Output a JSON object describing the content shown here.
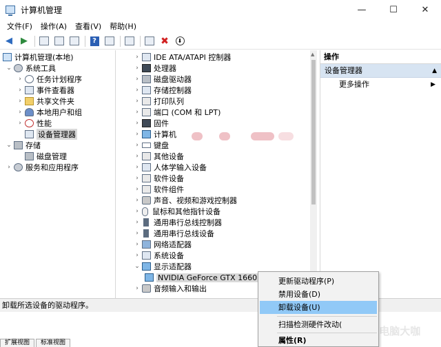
{
  "window": {
    "title": "计算机管理",
    "minimize": "—",
    "maximize": "☐",
    "close": "✕"
  },
  "menu": [
    "文件(F)",
    "操作(A)",
    "查看(V)",
    "帮助(H)"
  ],
  "left_tree": {
    "root": "计算机管理(本地)",
    "system_tools": "系统工具",
    "task_scheduler": "任务计划程序",
    "event_viewer": "事件查看器",
    "shared_folders": "共享文件夹",
    "local_users": "本地用户和组",
    "performance": "性能",
    "device_manager": "设备管理器",
    "storage": "存储",
    "disk_management": "磁盘管理",
    "services": "服务和应用程序"
  },
  "devices": {
    "ide": "IDE ATA/ATAPI 控制器",
    "processor": "处理器",
    "disk": "磁盘驱动器",
    "storage_ctrl": "存储控制器",
    "print_queue": "打印队列",
    "ports": "端口 (COM 和 LPT)",
    "firmware": "固件",
    "computer": "计算机",
    "keyboard": "键盘",
    "other": "其他设备",
    "hid": "人体学输入设备",
    "software_dev": "软件设备",
    "software_comp": "软件组件",
    "sound": "声音、视频和游戏控制器",
    "mouse": "鼠标和其他指针设备",
    "usb_ctrl": "通用串行总线控制器",
    "usb_dev": "通用串行总线设备",
    "network": "网络适配器",
    "system_dev": "系统设备",
    "display": "显示适配器",
    "gpu": "NVIDIA GeForce GTX 1660",
    "audio_io": "音频输入和输出"
  },
  "actions": {
    "header": "操作",
    "section": "设备管理器",
    "more": "更多操作"
  },
  "context_menu": {
    "update_driver": "更新驱动程序(P)",
    "disable": "禁用设备(D)",
    "uninstall": "卸载设备(U)",
    "scan": "扫描检测硬件改动(",
    "properties": "属性(R)"
  },
  "status": "卸载所选设备的驱动程序。",
  "bottom_tabs": [
    "扩展视图",
    "标准视图"
  ],
  "watermark": "头条号 电脑大咖"
}
